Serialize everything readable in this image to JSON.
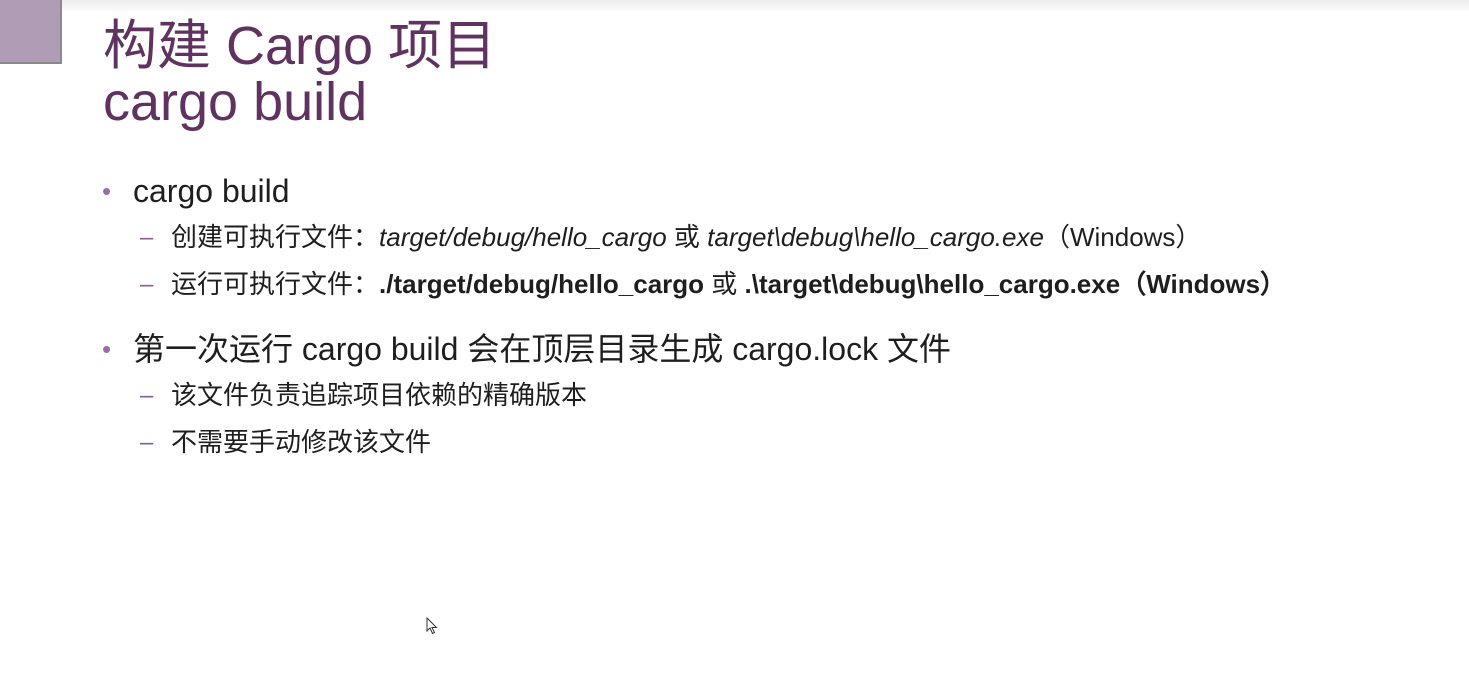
{
  "slide": {
    "title_line1": "构建 Cargo 项目",
    "title_line2": "cargo build",
    "bullets": [
      {
        "text": "cargo build",
        "subs": [
          {
            "label": "创建可执行文件：",
            "path1": "target/debug/hello_cargo",
            "sep": " 或 ",
            "path2": "target\\debug\\hello_cargo.exe",
            "suffix": "（Windows）"
          },
          {
            "label": "运行可执行文件：",
            "path1": "./target/debug/hello_cargo",
            "sep": " 或 ",
            "path2": ".\\target\\debug\\hello_cargo.exe",
            "suffix": "（Windows）"
          }
        ]
      },
      {
        "text": "第一次运行 cargo build 会在顶层目录生成 cargo.lock 文件",
        "subs": [
          {
            "text": "该文件负责追踪项目依赖的精确版本"
          },
          {
            "text": "不需要手动修改该文件"
          }
        ]
      }
    ]
  },
  "colors": {
    "title": "#60325f",
    "bullet": "#9b6aa8",
    "corner": "#b09cb4"
  },
  "icons": {
    "bullet": "•",
    "dash": "–",
    "cursor": "mouse-pointer-icon"
  }
}
